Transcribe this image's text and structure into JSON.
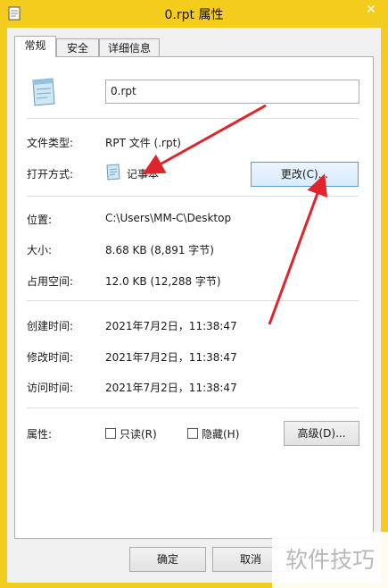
{
  "window": {
    "title": "0.rpt 属性",
    "close_glyph": "✕"
  },
  "tabs": [
    {
      "label": "常规"
    },
    {
      "label": "安全"
    },
    {
      "label": "详细信息"
    }
  ],
  "general": {
    "file_name": "0.rpt",
    "type_label": "文件类型:",
    "type_value": "RPT 文件 (.rpt)",
    "opens_with_label": "打开方式:",
    "opens_with_value": "记事本",
    "change_button": "更改(C)...",
    "location_label": "位置:",
    "location_value": "C:\\Users\\MM-C\\Desktop",
    "size_label": "大小:",
    "size_value": "8.68 KB (8,891 字节)",
    "disk_size_label": "占用空间:",
    "disk_size_value": "12.0 KB (12,288 字节)",
    "created_label": "创建时间:",
    "created_value": "2021年7月2日，11:38:47",
    "modified_label": "修改时间:",
    "modified_value": "2021年7月2日，11:38:47",
    "accessed_label": "访问时间:",
    "accessed_value": "2021年7月2日，11:38:47",
    "attributes_label": "属性:",
    "readonly_label": "只读(R)",
    "hidden_label": "隐藏(H)",
    "advanced_button": "高级(D)..."
  },
  "footer": {
    "ok_button": "确定",
    "cancel_button": "取消"
  },
  "watermark": "软件技巧",
  "colors": {
    "frame": "#f4cc1d",
    "arrow": "#e0242b",
    "focus": "#5c99d8"
  }
}
